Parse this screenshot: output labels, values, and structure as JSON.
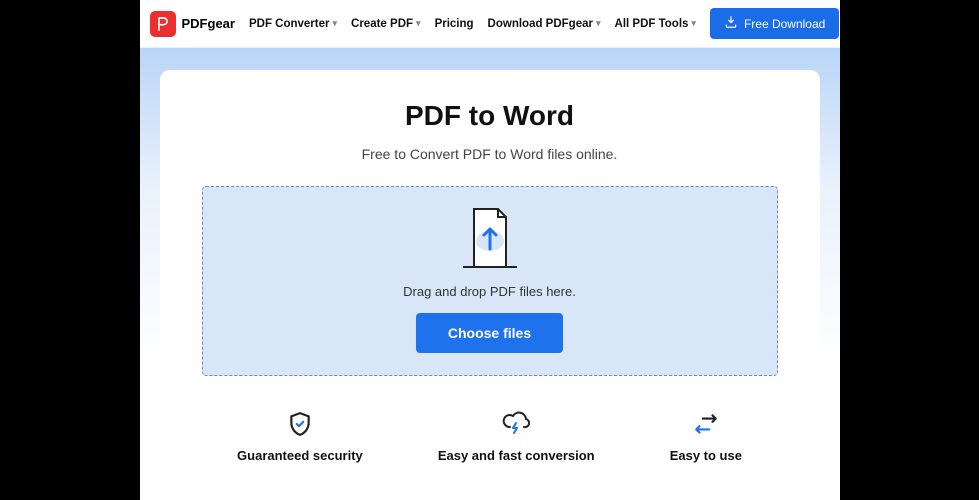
{
  "brand": "PDFgear",
  "nav": {
    "pdf_converter": "PDF Converter",
    "create_pdf": "Create PDF",
    "pricing": "Pricing",
    "download_pdfgear": "Download PDFgear",
    "all_pdf_tools": "All PDF Tools"
  },
  "header_cta": "Free Download",
  "hero": {
    "title": "PDF to Word",
    "subtitle": "Free to Convert PDF to Word files online."
  },
  "dropzone": {
    "hint": "Drag and drop PDF files here.",
    "button": "Choose files"
  },
  "features": {
    "security": "Guaranteed security",
    "conversion": "Easy and fast conversion",
    "easy": "Easy to use"
  }
}
